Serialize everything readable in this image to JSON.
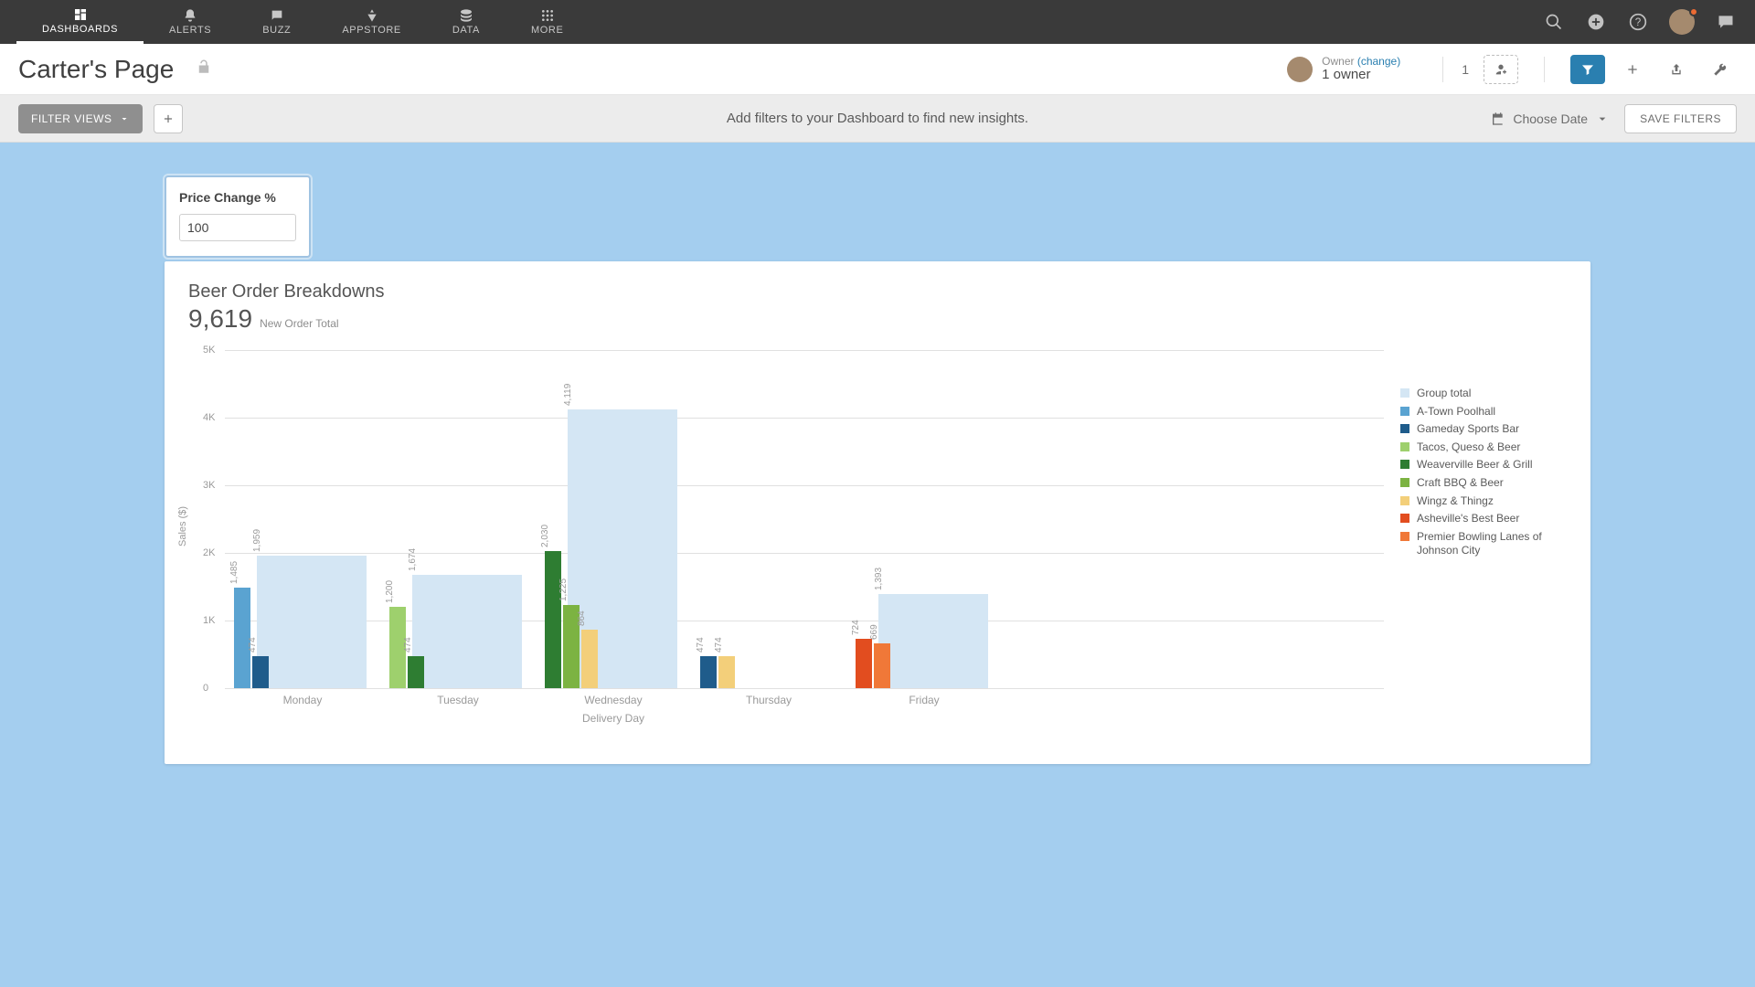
{
  "topnav": {
    "items": [
      {
        "label": "DASHBOARDS",
        "active": true
      },
      {
        "label": "ALERTS"
      },
      {
        "label": "BUZZ"
      },
      {
        "label": "APPSTORE"
      },
      {
        "label": "DATA"
      },
      {
        "label": "MORE"
      }
    ]
  },
  "header": {
    "page_title": "Carter's Page",
    "owner_label": "Owner",
    "change_label": "(change)",
    "owner_count_text": "1 owner",
    "people_count": "1"
  },
  "subbar": {
    "filter_views_label": "FILTER VIEWS",
    "hint": "Add filters to your Dashboard to find new insights.",
    "choose_date_label": "Choose Date",
    "save_filters_label": "SAVE FILTERS"
  },
  "input_card": {
    "label": "Price Change %",
    "value": "100"
  },
  "chart_card": {
    "title": "Beer Order Breakdowns",
    "metric_value": "9,619",
    "metric_label": "New Order Total"
  },
  "chart_data": {
    "type": "bar",
    "title": "Beer Order Breakdowns",
    "xlabel": "Delivery Day",
    "ylabel": "Sales ($)",
    "ylim": [
      0,
      5000
    ],
    "yticks": [
      0,
      1000,
      2000,
      3000,
      4000,
      5000
    ],
    "ytick_labels": [
      "0",
      "1K",
      "2K",
      "3K",
      "4K",
      "5K"
    ],
    "categories": [
      "Monday",
      "Tuesday",
      "Wednesday",
      "Thursday",
      "Friday"
    ],
    "group_total": {
      "name": "Group total",
      "color": "#d4e6f4",
      "values": [
        1959,
        1674,
        4119,
        null,
        1393
      ]
    },
    "series": [
      {
        "name": "A-Town Poolhall",
        "color": "#5aa3d1",
        "values": [
          1485,
          null,
          null,
          null,
          null
        ]
      },
      {
        "name": "Gameday Sports Bar",
        "color": "#1f5c8b",
        "values": [
          474,
          null,
          null,
          474,
          null
        ]
      },
      {
        "name": "Tacos, Queso & Beer",
        "color": "#9ed06d",
        "values": [
          null,
          1200,
          null,
          null,
          null
        ]
      },
      {
        "name": "Weaverville Beer & Grill",
        "color": "#2e7d32",
        "values": [
          null,
          474,
          2030,
          null,
          null
        ]
      },
      {
        "name": "Craft BBQ & Beer",
        "color": "#7cb342",
        "values": [
          null,
          null,
          1225,
          null,
          null
        ]
      },
      {
        "name": "Wingz & Thingz",
        "color": "#f3cf7a",
        "values": [
          null,
          null,
          864,
          474,
          null
        ]
      },
      {
        "name": "Asheville's Best Beer",
        "color": "#e24d1f",
        "values": [
          null,
          null,
          null,
          null,
          724
        ]
      },
      {
        "name": "Premier Bowling Lanes of Johnson City",
        "color": "#f07838",
        "values": [
          null,
          null,
          null,
          null,
          669
        ]
      }
    ]
  }
}
